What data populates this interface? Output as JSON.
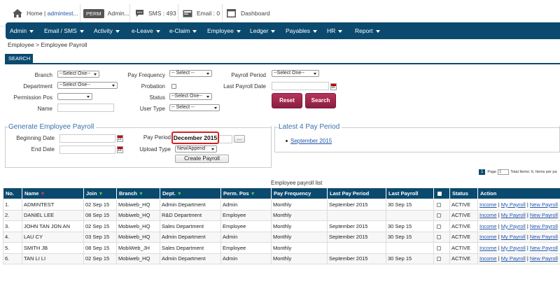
{
  "topbar": {
    "home_label": "Home | ",
    "user": "admintest...",
    "perm_badge": "PERM",
    "perm_label": "Admin...",
    "sms_label": "SMS : 493",
    "email_label": "Email : 0",
    "dashboard_label": "Dashboard"
  },
  "nav": {
    "items": [
      "Admin",
      "Email / SMS",
      "Activity",
      "e-Leave",
      "e-Claim",
      "Employee",
      "Ledger",
      "Payables",
      "HR",
      "Report"
    ]
  },
  "breadcrumb": "Employee > Employee Payroll",
  "search": {
    "header": "SEARCH",
    "branch_label": "Branch",
    "branch_value": "--Select One--",
    "department_label": "Department",
    "department_value": "--Select One--",
    "permission_label": "Permission Pos",
    "permission_value": "",
    "name_label": "Name",
    "pay_frequency_label": "Pay Frequency",
    "pay_frequency_value": "-- Select --",
    "probation_label": "Probation",
    "status_label": "Status",
    "status_value": "--Select One--",
    "user_type_label": "User Type",
    "user_type_value": "-- Select --",
    "payroll_period_label": "Payroll Period",
    "payroll_period_value": "--Select One--",
    "last_payroll_date_label": "Last Payroll Date",
    "reset_label": "Reset",
    "search_label": "Search"
  },
  "generate": {
    "title": "Generate Employee Payroll",
    "beginning_date_label": "Beginning Date",
    "end_date_label": "End Date",
    "pay_period_label": "Pay Period",
    "pay_period_value": "December 2015",
    "browse_label": "...",
    "upload_type_label": "Upload Type",
    "upload_type_value": "New/Append",
    "create_label": "Create Payroll"
  },
  "latest": {
    "title": "Latest 4 Pay Period",
    "items": [
      "September 2015"
    ]
  },
  "pager": {
    "current": "1",
    "page_label": "Page",
    "page_value": "1",
    "info": "Total Items: 6, Items per pa"
  },
  "list_title": "Employee payroll list",
  "table": {
    "headers": [
      "No.",
      "Name",
      "Join",
      "Branch",
      "Dept.",
      "Perm. Pos",
      "Pay Frequency",
      "Last Pay Period",
      "Last Payroll",
      "",
      "Status",
      "Action"
    ],
    "rows": [
      [
        "1.",
        "ADMINTEST",
        "02 Sep 15",
        "Mobiweb_HQ",
        "Admin Department",
        "Admin",
        "Monthly",
        "September 2015",
        "30 Sep 15",
        "",
        "ACTIVE"
      ],
      [
        "2.",
        "DANIEL LEE",
        "08 Sep 15",
        "Mobiweb_HQ",
        "R&D Department",
        "Employee",
        "Monthly",
        "",
        "",
        "",
        "ACTIVE"
      ],
      [
        "3.",
        "JOHN TAN JON AN",
        "02 Sep 15",
        "Mobiweb_HQ",
        "Sales Department",
        "Employee",
        "Monthly",
        "September 2015",
        "30 Sep 15",
        "",
        "ACTIVE"
      ],
      [
        "4.",
        "LAU CY",
        "03 Sep 15",
        "Mobiweb_HQ",
        "Admin Department",
        "Admin",
        "Monthly",
        "September 2015",
        "30 Sep 15",
        "",
        "ACTIVE"
      ],
      [
        "5.",
        "SMITH JB",
        "08 Sep 15",
        "MobiWeb_JH",
        "Sales Department",
        "Employee",
        "Monthly",
        "",
        "",
        "",
        "ACTIVE"
      ],
      [
        "6.",
        "TAN LI LI",
        "02 Sep 15",
        "Mobiweb_HQ",
        "Admin Department",
        "Admin",
        "Monthly",
        "September 2015",
        "30 Sep 15",
        "",
        "ACTIVE"
      ]
    ],
    "action_income": "Income",
    "action_my_payroll": "My Payroll",
    "action_new_payroll": "New Payroll",
    "action_sep": " | "
  }
}
